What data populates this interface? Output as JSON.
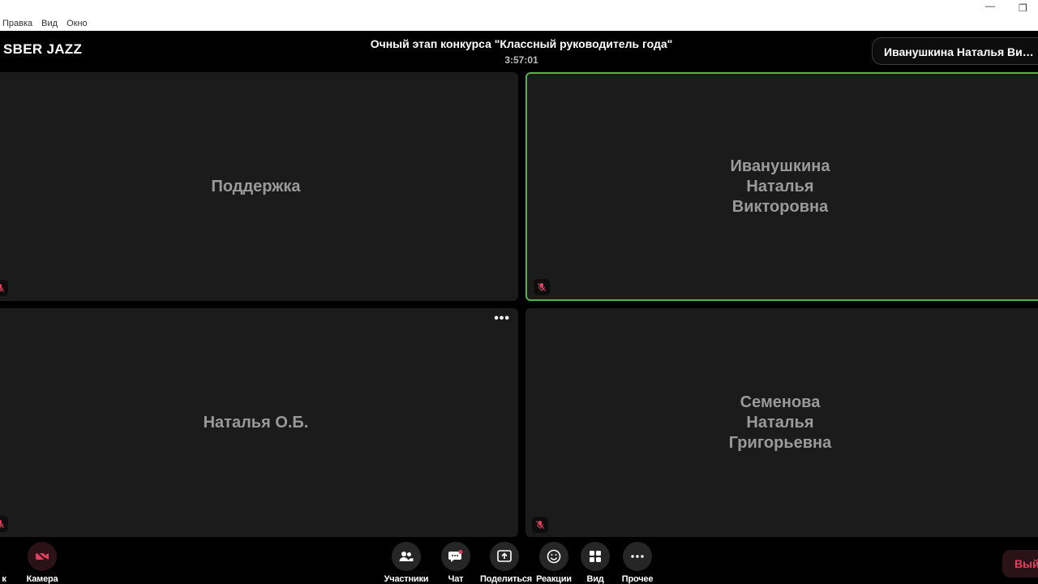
{
  "menu": {
    "items": [
      "Правка",
      "Вид",
      "Окно"
    ]
  },
  "window_controls": {
    "minimize": "—",
    "restore": "❐"
  },
  "app": {
    "logo": "SBER JAZZ"
  },
  "meeting": {
    "title": "Очный этап конкурса \"Классный руководитель года\"",
    "timer": "3:57:01",
    "current_user": "Иванушкина Наталья Ви…"
  },
  "participants": [
    {
      "name": "Поддержка",
      "muted": true,
      "speaking": false
    },
    {
      "name": "Иванушкина Наталья Викторовна",
      "muted": true,
      "speaking": true
    },
    {
      "name": "Наталья О.Б.",
      "muted": true,
      "speaking": false,
      "menu": "•••"
    },
    {
      "name": "Семенова Наталья Григорьевна",
      "muted": true,
      "speaking": false
    }
  ],
  "toolbar": {
    "mic_label": "к",
    "camera_label": "Камера",
    "participants_label": "Участники",
    "chat_label": "Чат",
    "share_label": "Поделиться",
    "reactions_label": "Реакции",
    "view_label": "Вид",
    "more_label": "Прочее",
    "exit_label": "Выйти"
  },
  "colors": {
    "accent_speaking": "#4cb848",
    "muted_red": "#e0405e",
    "tile_bg": "#1b1b1b"
  }
}
